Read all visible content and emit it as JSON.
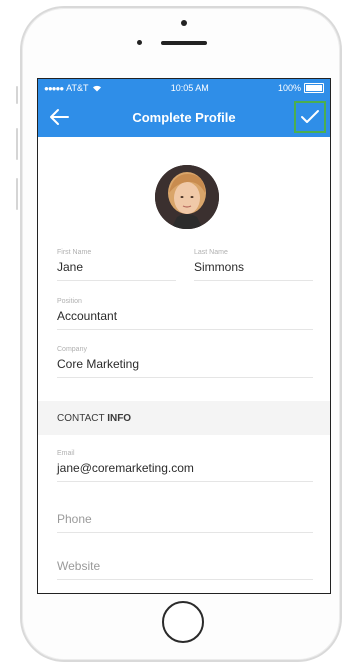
{
  "statusbar": {
    "carrier": "AT&T",
    "time": "10:05 AM",
    "battery": "100%"
  },
  "navbar": {
    "title": "Complete Profile",
    "back_icon": "arrow-left-icon",
    "confirm_icon": "checkmark-icon"
  },
  "profile": {
    "first_name_label": "First Name",
    "first_name": "Jane",
    "last_name_label": "Last Name",
    "last_name": "Simmons",
    "position_label": "Position",
    "position": "Accountant",
    "company_label": "Company",
    "company": "Core Marketing"
  },
  "contact": {
    "section_title_prefix": "CONTACT",
    "section_title_bold": "INFO",
    "email_label": "Email",
    "email": "jane@coremarketing.com",
    "phone_placeholder": "Phone",
    "website_placeholder": "Website"
  },
  "colors": {
    "primary": "#2f8ee8",
    "confirm_outline": "#4caf50"
  }
}
